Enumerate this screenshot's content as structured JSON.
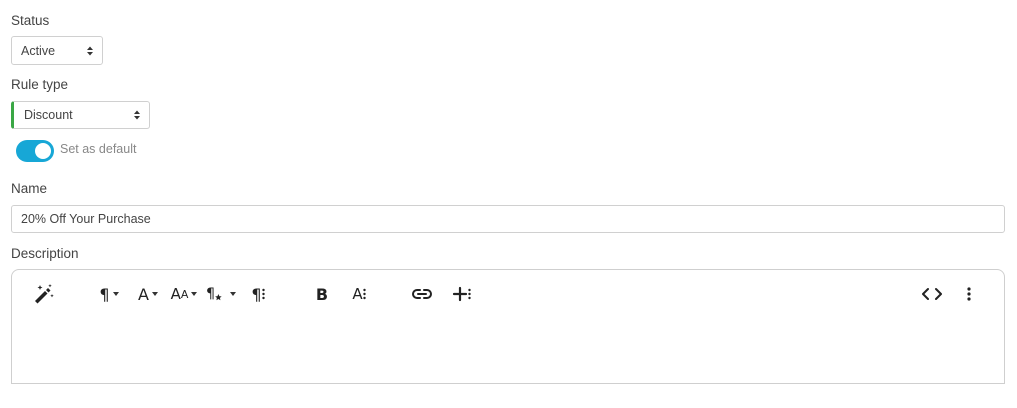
{
  "status": {
    "label": "Status",
    "value": "Active"
  },
  "rule_type": {
    "label": "Rule type",
    "value": "Discount"
  },
  "default_toggle": {
    "label": "Set as default",
    "on": true
  },
  "name": {
    "label": "Name",
    "value": "20% Off Your Purchase"
  },
  "description": {
    "label": "Description",
    "toolbar": [
      "magic-wand-icon",
      "paragraph-format-icon",
      "font-family-icon",
      "font-size-icon",
      "paragraph-style-icon",
      "more-paragraph-icon",
      "bold-icon",
      "more-text-icon",
      "link-icon",
      "more-insert-icon",
      "code-view-icon",
      "more-misc-icon"
    ]
  },
  "colors": {
    "accent": "#17a7d6",
    "rule_type_bar": "#3aa745"
  }
}
